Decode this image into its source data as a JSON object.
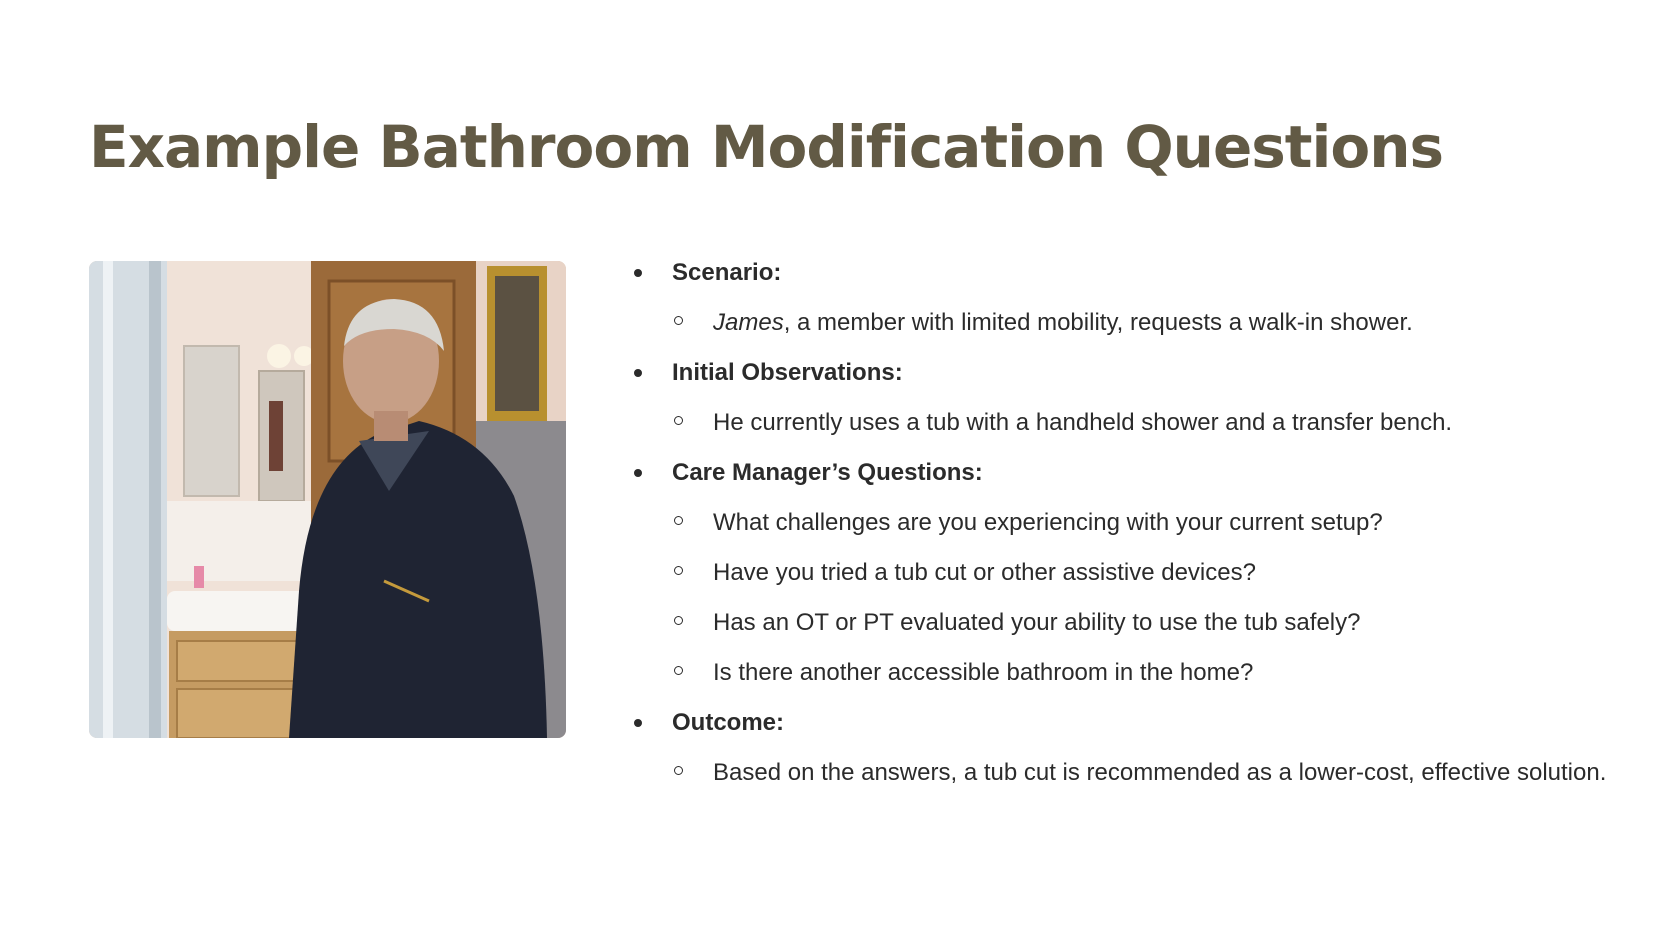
{
  "slide": {
    "title": "Example Bathroom Modification Questions"
  },
  "photo": {
    "alt": "Elderly man standing in a bathroom doorway"
  },
  "bullets": [
    {
      "label": "Scenario:",
      "subs": [
        {
          "name_em": "James",
          "text": ", a member with limited mobility, requests a walk-in shower."
        }
      ]
    },
    {
      "label": "Initial Observations:",
      "subs": [
        {
          "text": "He currently uses a tub with a handheld shower and a transfer bench."
        }
      ]
    },
    {
      "label": "Care Manager’s Questions:",
      "subs": [
        {
          "text": "What challenges are you experiencing with your current setup?"
        },
        {
          "text": "Have you tried a tub cut or other assistive devices?"
        },
        {
          "text": "Has an OT or PT evaluated your ability to use the tub safely?"
        },
        {
          "text": "Is there another accessible bathroom in the home?"
        }
      ]
    },
    {
      "label": "Outcome:",
      "subs": [
        {
          "text": "Based on the answers, a tub cut is recommended as a lower-cost, effective solution."
        }
      ]
    }
  ],
  "colors": {
    "title": "#625a45",
    "body_text": "#2b2b2b"
  }
}
